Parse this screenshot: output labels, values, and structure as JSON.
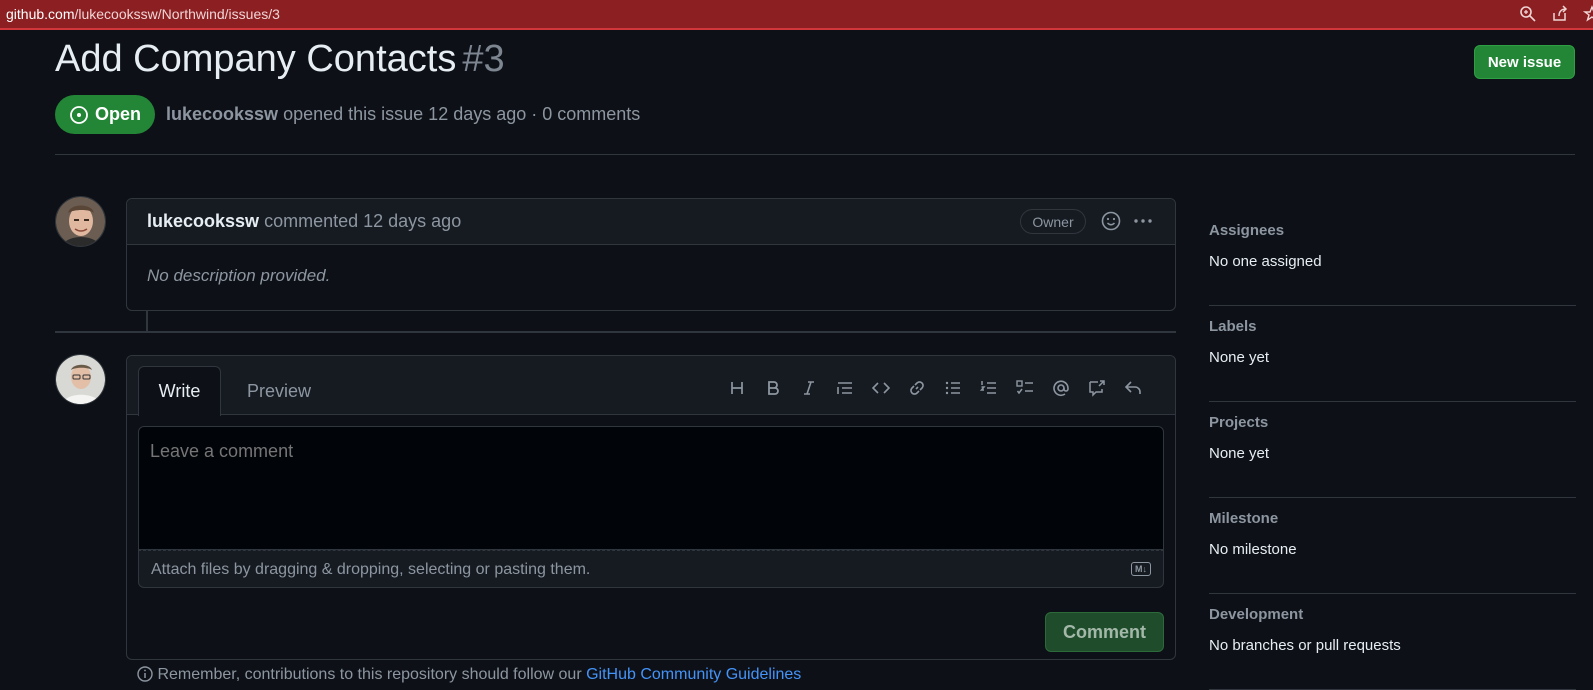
{
  "browser": {
    "url_host": "github.com",
    "url_path": "/lukecookssw/Northwind/issues/3"
  },
  "issue": {
    "title": "Add Company Contacts",
    "number": "#3",
    "state": "Open",
    "author": "lukecookssw",
    "meta_text": "opened this issue 12 days ago · 0 comments",
    "new_issue_label": "New issue"
  },
  "comment": {
    "author": "lukecookssw",
    "action": "commented 12 days ago",
    "role_badge": "Owner",
    "body": "No description provided."
  },
  "editor": {
    "tab_write": "Write",
    "tab_preview": "Preview",
    "placeholder": "Leave a comment",
    "attach_text": "Attach files by dragging & dropping, selecting or pasting them.",
    "md_badge": "M↓",
    "submit_label": "Comment",
    "toolbar": [
      "heading-icon",
      "bold-icon",
      "italic-icon",
      "quote-icon",
      "code-icon",
      "link-icon",
      "bulleted-list-icon",
      "numbered-list-icon",
      "task-list-icon",
      "mention-icon",
      "reference-icon",
      "reply-icon"
    ]
  },
  "guideline": {
    "prefix": "Remember, contributions to this repository should follow our ",
    "link": "GitHub Community Guidelines"
  },
  "sidebar": {
    "sections": [
      {
        "heading": "Assignees",
        "value": "No one assigned"
      },
      {
        "heading": "Labels",
        "value": "None yet"
      },
      {
        "heading": "Projects",
        "value": "None yet"
      },
      {
        "heading": "Milestone",
        "value": "No milestone"
      },
      {
        "heading": "Development",
        "value": "No branches or pull requests"
      }
    ]
  },
  "colors": {
    "background": "#0d1117",
    "accent_green": "#238636",
    "browser_bar": "#8b1f22",
    "link_blue": "#4493f8"
  }
}
